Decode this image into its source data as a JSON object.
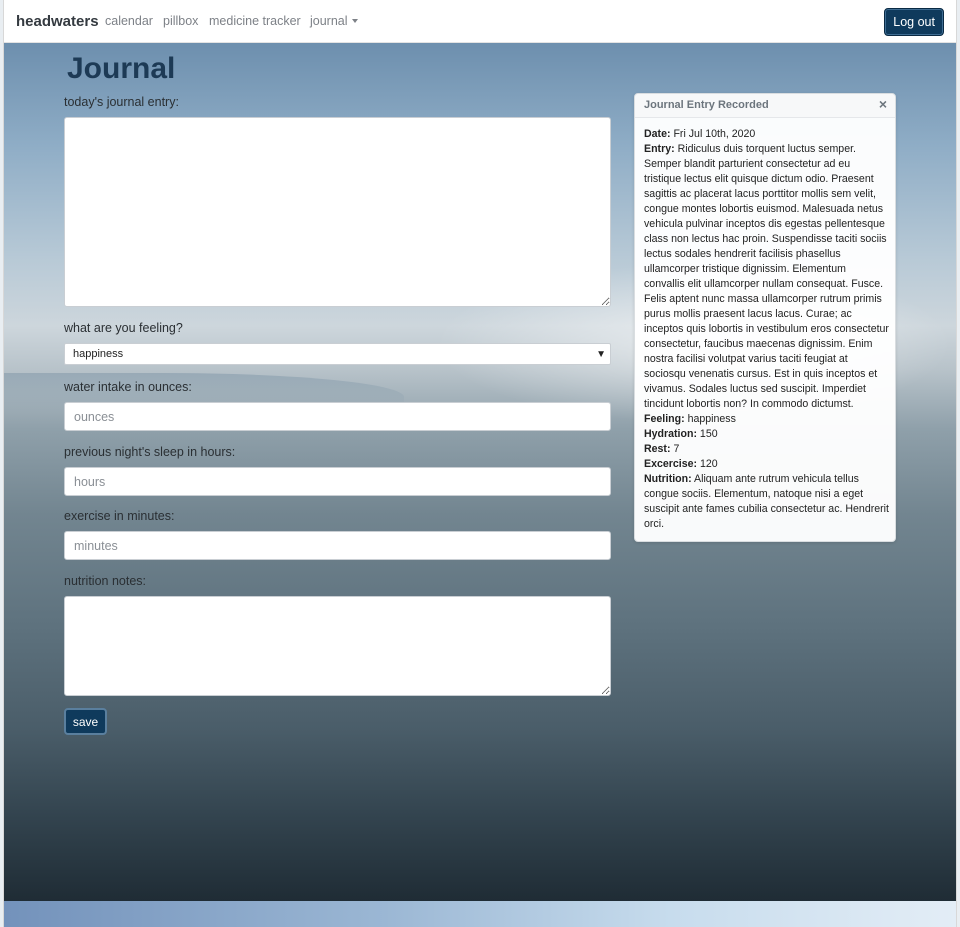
{
  "navbar": {
    "brand": "headwaters",
    "links": [
      "calendar",
      "pillbox",
      "medicine tracker"
    ],
    "dropdown_label": "journal",
    "logout_label": "Log out"
  },
  "page": {
    "title": "Journal"
  },
  "form": {
    "entry_label": "today's journal entry:",
    "entry_value": "",
    "feeling_label": "what are you feeling?",
    "feeling_selected": "happiness",
    "water_label": "water intake in ounces:",
    "water_placeholder": "ounces",
    "sleep_label": "previous night's sleep in hours:",
    "sleep_placeholder": "hours",
    "exercise_label": "exercise in minutes:",
    "exercise_placeholder": "minutes",
    "nutrition_label": "nutrition notes:",
    "nutrition_value": "",
    "save_label": "save"
  },
  "toast": {
    "title": "Journal Entry Recorded",
    "close_glyph": "×",
    "date_label": "Date:",
    "date_value": "Fri Jul 10th, 2020",
    "entry_label": "Entry:",
    "entry_value": "Ridiculus duis torquent luctus semper. Semper blandit parturient consectetur ad eu tristique lectus elit quisque dictum odio. Praesent sagittis ac placerat lacus porttitor mollis sem velit, congue montes lobortis euismod. Malesuada netus vehicula pulvinar inceptos dis egestas pellentesque class non lectus hac proin. Suspendisse taciti sociis lectus sodales hendrerit facilisis phasellus ullamcorper tristique dignissim. Elementum convallis elit ullamcorper nullam consequat. Fusce. Felis aptent nunc massa ullamcorper rutrum primis purus mollis praesent lacus lacus. Curae; ac inceptos quis lobortis in vestibulum eros consectetur consectetur, faucibus maecenas dignissim. Enim nostra facilisi volutpat varius taciti feugiat at sociosqu venenatis cursus. Est in quis inceptos et vivamus. Sodales luctus sed suscipit. Imperdiet tincidunt lobortis non? In commodo dictumst.",
    "feeling_label": "Feeling:",
    "feeling_value": "happiness",
    "hydration_label": "Hydration:",
    "hydration_value": "150",
    "rest_label": "Rest:",
    "rest_value": "7",
    "exercise_label": "Excercise:",
    "exercise_value": "120",
    "nutrition_label": "Nutrition:",
    "nutrition_value": "Aliquam ante rutrum vehicula tellus congue sociis. Elementum, natoque nisi a eget suscipit ante fames cubilia consectetur ac. Hendrerit orci."
  },
  "colors": {
    "primary_button": "#0f3a5c",
    "title": "#1d3a55"
  }
}
